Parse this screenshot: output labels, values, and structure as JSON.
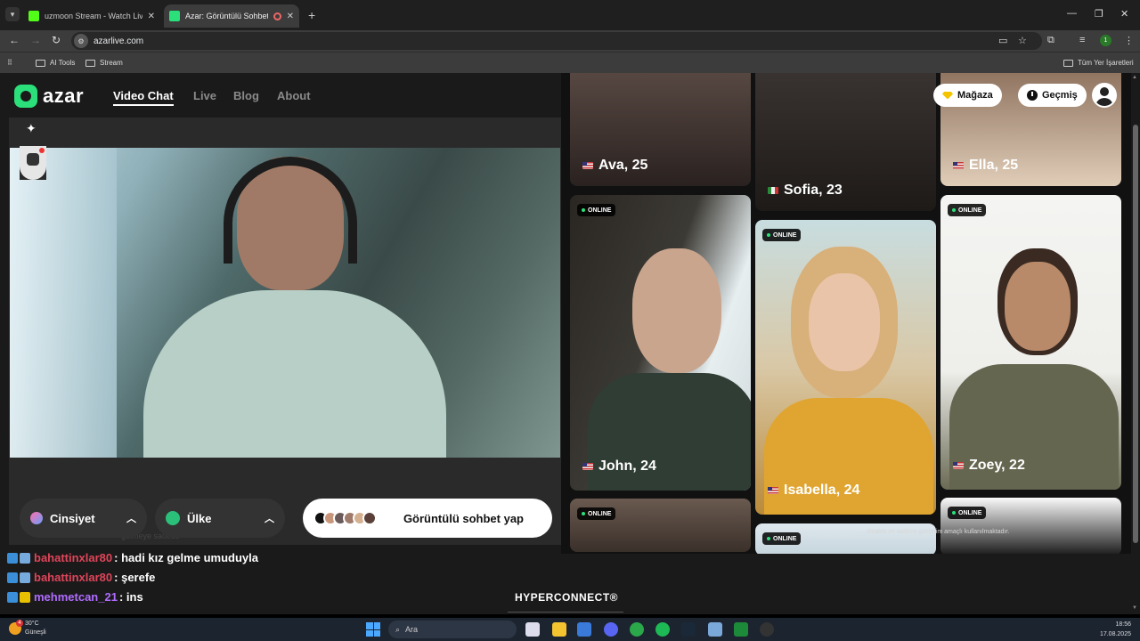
{
  "browser": {
    "tabs": [
      {
        "title": "uzmoon Stream - Watch Live o",
        "favicon_color": "#53fc18"
      },
      {
        "title": "Azar: Görüntülü Sohbet, Ar",
        "favicon_color": "#2be07a"
      }
    ],
    "url": "azarlive.com",
    "bookmarks": [
      "AI Tools",
      "Stream"
    ],
    "all_bookmarks": "Tüm Yer İşaretleri",
    "profile_initial": "1"
  },
  "azar": {
    "logo": "azar",
    "nav": [
      "Video Chat",
      "Live",
      "Blog",
      "About"
    ],
    "store_label": "Mağaza",
    "history_label": "Geçmiş",
    "filters": {
      "gender": "Cinsiyet",
      "country": "Ülke"
    },
    "cta_label": "Görüntülü sohbet yap",
    "ghost_text": "gelmeye sadece",
    "footer_brand": "HYPERCONNECT®",
    "online_label": "ONLINE",
    "cards": [
      {
        "name": "Ava, 25",
        "country": "us",
        "online": false
      },
      {
        "name": "Sofia, 23",
        "country": "it",
        "online": false
      },
      {
        "name": "Ella, 25",
        "country": "us",
        "online": false
      },
      {
        "name": "John, 24",
        "country": "us",
        "online": true
      },
      {
        "name": "Isabella, 24",
        "country": "us",
        "online": true
      },
      {
        "name": "Zoey, 22",
        "country": "us",
        "online": true
      },
      {
        "name": "",
        "country": "",
        "online": true
      },
      {
        "name": "",
        "country": "",
        "online": true
      },
      {
        "name": "",
        "country": "",
        "online": true
      }
    ],
    "zoey_caption": "…ılmakta ve sadece gösterim amaçlı kullanılmaktadır."
  },
  "chat": [
    {
      "user": "bahattinxlar80",
      "user_color": "#e0455a",
      "msg": ": hadi kız gelme umuduyla"
    },
    {
      "user": "bahattinxlar80",
      "user_color": "#e0455a",
      "msg": ": şerefe"
    },
    {
      "user": "mehmetcan_21",
      "user_color": "#b06cff",
      "msg": ": ins"
    }
  ],
  "taskbar": {
    "temp": "30°C",
    "weather": "Güneşli",
    "weather_badge": "4",
    "search": "Ara",
    "time": "18:56",
    "date": "17.08.2025"
  }
}
